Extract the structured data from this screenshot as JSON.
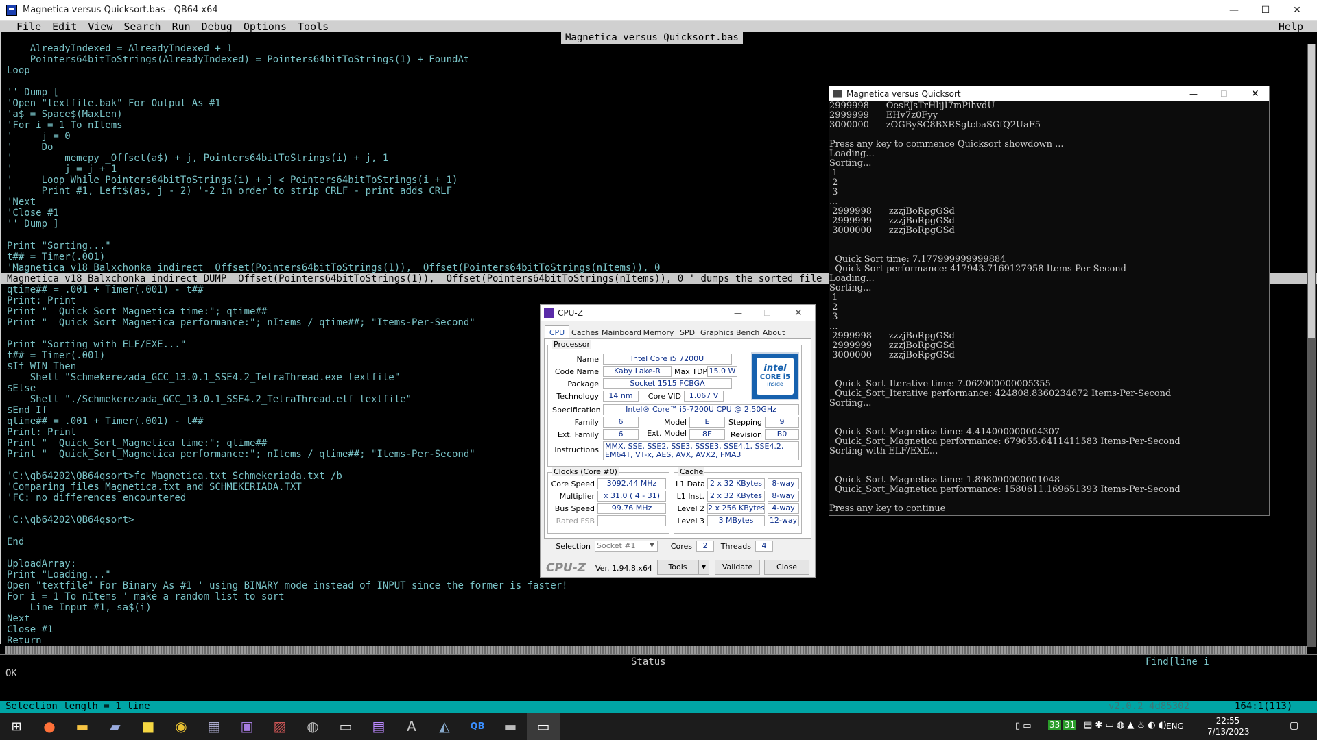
{
  "window": {
    "title": "Magnetica versus Quicksort.bas - QB64 x64",
    "minimize": "—",
    "maximize": "☐",
    "close": "✕"
  },
  "menu": {
    "items": [
      "File",
      "Edit",
      "View",
      "Search",
      "Run",
      "Debug",
      "Options",
      "Tools"
    ],
    "help": "Help"
  },
  "editor": {
    "file_title": "Magnetica versus Quicksort.bas",
    "lines": [
      "    AlreadyIndexed = AlreadyIndexed + 1",
      "    Pointers64bitToStrings(AlreadyIndexed) = Pointers64bitToStrings(1) + FoundAt",
      "Loop",
      "",
      "'' Dump [",
      "'Open \"textfile.bak\" For Output As #1",
      "'a$ = Space$(MaxLen)",
      "'For i = 1 To nItems",
      "'     j = 0",
      "'     Do",
      "'         memcpy _Offset(a$) + j, Pointers64bitToStrings(i) + j, 1",
      "'         j = j + 1",
      "'     Loop While Pointers64bitToStrings(i) + j < Pointers64bitToStrings(i + 1)",
      "'     Print #1, Left$(a$, j - 2) '-2 in order to strip CRLF - print adds CRLF",
      "'Next",
      "'Close #1",
      "'' Dump ]",
      "",
      "Print \"Sorting...\"",
      "t## = Timer(.001)",
      "'Magnetica_v18_Balxchonka_indirect _Offset(Pointers64bitToStrings(1)), _Offset(Pointers64bitToStrings(nItems)), 0",
      "Magnetica_v18_Balxchonka_indirect_DUMP _Offset(Pointers64bitToStrings(1)), _Offset(Pointers64bitToStrings(nItems)), 0 ' dumps the sorted file into 'Ma",
      "qtime## = .001 + Timer(.001) - t##",
      "Print: Print",
      "Print \"  Quick_Sort_Magnetica time:\"; qtime##",
      "Print \"  Quick_Sort_Magnetica performance:\"; nItems / qtime##; \"Items-Per-Second\"",
      "",
      "Print \"Sorting with ELF/EXE...\"",
      "t## = Timer(.001)",
      "$If WIN Then",
      "    Shell \"Schmekerezada_GCC_13.0.1_SSE4.2_TetraThread.exe textfile\"",
      "$Else",
      "    Shell \"./Schmekerezada_GCC_13.0.1_SSE4.2_TetraThread.elf textfile\"",
      "$End If",
      "qtime## = .001 + Timer(.001) - t##",
      "Print: Print",
      "Print \"  Quick_Sort_Magnetica time:\"; qtime##",
      "Print \"  Quick_Sort_Magnetica performance:\"; nItems / qtime##; \"Items-Per-Second\"",
      "",
      "'C:\\qb64202\\QB64qsort>fc Magnetica.txt Schmekeriada.txt /b",
      "'Comparing files Magnetica.txt and SCHMEKERIADA.TXT",
      "'FC: no differences encountered",
      "",
      "'C:\\qb64202\\QB64qsort>",
      "",
      "End",
      "",
      "UploadArray:",
      "Print \"Loading...\"",
      "Open \"textfile\" For Binary As #1 ' using BINARY mode instead of INPUT since the former is faster!",
      "For i = 1 To nItems ' make a random list to sort",
      "    Line Input #1, sa$(i)",
      "Next",
      "Close #1",
      "Return"
    ],
    "highlight_index": 21
  },
  "status": {
    "label": "Status",
    "find": "Find[line i",
    "message": "OK",
    "selection": "Selection length = 1 line",
    "version": "v2.0.2 4d85302",
    "position": "164:1(113)"
  },
  "console": {
    "title": "Magnetica versus Quicksort",
    "lines": [
      "2999998      OesEJsTrHlijI7mPihvdU",
      "2999999      EHv7z0Fyy",
      "3000000      zOGBySC8BXRSgtcbaSGfQ2UaF5",
      "",
      "Press any key to commence Quicksort showdown ...",
      "Loading...",
      "Sorting...",
      " 1",
      " 2",
      " 3",
      "...",
      " 2999998      zzzjBoRpgGSd",
      " 2999999      zzzjBoRpgGSd",
      " 3000000      zzzjBoRpgGSd",
      "",
      "",
      "  Quick Sort time: 7.177999999999884",
      "  Quick Sort performance: 417943.7169127958 Items-Per-Second",
      "Loading...",
      "Sorting...",
      " 1",
      " 2",
      " 3",
      "...",
      " 2999998      zzzjBoRpgGSd",
      " 2999999      zzzjBoRpgGSd",
      " 3000000      zzzjBoRpgGSd",
      "",
      "",
      "  Quick_Sort_Iterative time: 7.062000000005355",
      "  Quick_Sort_Iterative performance: 424808.8360234672 Items-Per-Second",
      "Sorting...",
      "",
      "",
      "  Quick_Sort_Magnetica time: 4.414000000004307",
      "  Quick_Sort_Magnetica performance: 679655.6411411583 Items-Per-Second",
      "Sorting with ELF/EXE...",
      "",
      "",
      "  Quick_Sort_Magnetica time: 1.898000000001048",
      "  Quick_Sort_Magnetica performance: 1580611.169651393 Items-Per-Second",
      "",
      "Press any key to continue"
    ]
  },
  "cpuz": {
    "title": "CPU-Z",
    "tabs": [
      "CPU",
      "Caches",
      "Mainboard",
      "Memory",
      "SPD",
      "Graphics",
      "Bench",
      "About"
    ],
    "processor_label": "Processor",
    "name_label": "Name",
    "name": "Intel Core i5 7200U",
    "codename_label": "Code Name",
    "codename": "Kaby Lake-R",
    "maxtdp_label": "Max TDP",
    "maxtdp": "15.0 W",
    "package_label": "Package",
    "package": "Socket 1515 FCBGA",
    "technology_label": "Technology",
    "technology": "14 nm",
    "corevid_label": "Core VID",
    "corevid": "1.067 V",
    "spec_label": "Specification",
    "spec": "Intel® Core™ i5-7200U CPU @ 2.50GHz",
    "family_label": "Family",
    "family": "6",
    "model_label": "Model",
    "model": "E",
    "stepping_label": "Stepping",
    "stepping": "9",
    "extfamily_label": "Ext. Family",
    "extfamily": "6",
    "extmodel_label": "Ext. Model",
    "extmodel": "8E",
    "revision_label": "Revision",
    "revision": "B0",
    "instructions_label": "Instructions",
    "instructions": "MMX, SSE, SSE2, SSE3, SSSE3, SSE4.1, SSE4.2, EM64T, VT-x, AES, AVX, AVX2, FMA3",
    "logo_brand": "intel",
    "logo_line1": "CORE i5",
    "logo_line2": "inside",
    "clocks_label": "Clocks (Core #0)",
    "corespeed_label": "Core Speed",
    "corespeed": "3092.44 MHz",
    "multiplier_label": "Multiplier",
    "multiplier": "x 31.0 ( 4 - 31)",
    "busspeed_label": "Bus Speed",
    "busspeed": "99.76 MHz",
    "ratedfsb_label": "Rated FSB",
    "ratedfsb": "",
    "cache_label": "Cache",
    "l1d_label": "L1 Data",
    "l1d": "2 x 32 KBytes",
    "l1d_way": "8-way",
    "l1i_label": "L1 Inst.",
    "l1i": "2 x 32 KBytes",
    "l1i_way": "8-way",
    "l2_label": "Level 2",
    "l2": "2 x 256 KBytes",
    "l2_way": "4-way",
    "l3_label": "Level 3",
    "l3": "3 MBytes",
    "l3_way": "12-way",
    "selection_label": "Selection",
    "selection": "Socket #1",
    "cores_label": "Cores",
    "cores": "2",
    "threads_label": "Threads",
    "threads": "4",
    "brand": "CPU-Z",
    "version": "Ver. 1.94.8.x64",
    "tools_btn": "Tools",
    "validate_btn": "Validate",
    "close_btn": "Close"
  },
  "taskbar": {
    "lang": "ENG",
    "time": "22:55",
    "date": "7/13/2023",
    "tray_num1": "33",
    "tray_num2": "31"
  }
}
